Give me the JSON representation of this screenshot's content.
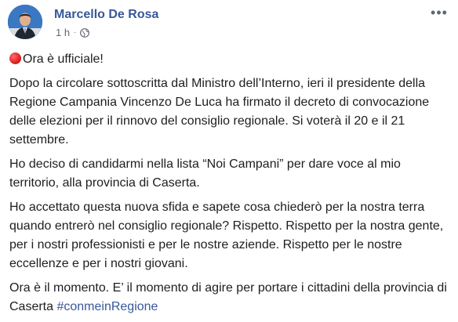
{
  "post": {
    "author": "Marcello De Rosa",
    "time": "1 h",
    "separator": "·",
    "privacy_icon": "globe-icon",
    "more_icon": "more-options-icon",
    "avatar": "profile-avatar",
    "headline_icon": "red-circle-emoji",
    "headline": "Ora è ufficiale!",
    "paragraphs": [
      "Dopo la circolare sottoscritta dal Ministro dell’Interno, ieri il presidente della Regione Campania Vincenzo De Luca ha firmato il decreto di convocazione delle elezioni per il rinnovo del consiglio regionale. Si voterà il 20 e il 21 settembre.",
      "Ho deciso di candidarmi nella lista “Noi Campani” per dare voce al mio territorio, alla provincia di Caserta.",
      "Ho accettato questa nuova sfida e sapete cosa chiederò per la nostra terra quando entrerò nel consiglio regionale? Rispetto. Rispetto per la nostra gente, per i nostri professionisti e per le nostre aziende. Rispetto per le nostre eccellenze e per i nostri giovani."
    ],
    "closing_text": "Ora è il momento. E’ il momento di agire per portare i cittadini della provincia di Caserta ",
    "hashtag": "#conmeinRegione"
  },
  "colors": {
    "author": "#385898",
    "meta": "#606770",
    "text": "#1c1e21",
    "hashtag": "#385898"
  }
}
